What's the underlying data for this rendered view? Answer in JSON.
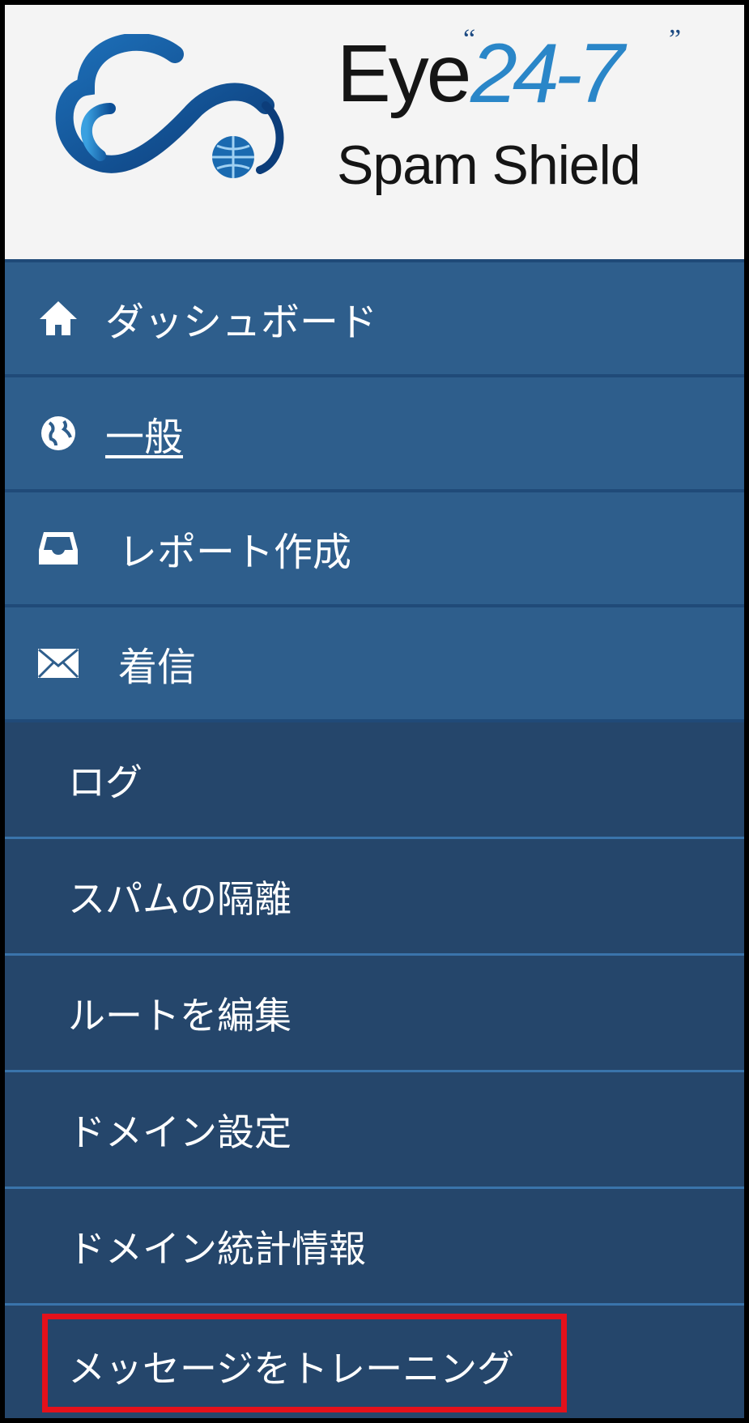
{
  "logo": {
    "brand": "Eye",
    "number": "24-7",
    "quote_open": "“",
    "quote_close": "”",
    "product": "Spam Shield"
  },
  "menu": {
    "items": [
      {
        "label": "ダッシュボード",
        "icon": "home-icon"
      },
      {
        "label": "一般",
        "icon": "globe-icon"
      },
      {
        "label": "レポート作成",
        "icon": "inbox-icon"
      },
      {
        "label": "着信",
        "icon": "envelope-icon"
      }
    ],
    "subitems": [
      {
        "label": "ログ"
      },
      {
        "label": "スパムの隔離"
      },
      {
        "label": "ルートを編集"
      },
      {
        "label": "ドメイン設定"
      },
      {
        "label": "ドメイン統計情報"
      },
      {
        "label": "メッセージをトレーニング"
      }
    ]
  },
  "colors": {
    "header_bg": "#f4f4f4",
    "main_item_bg": "#2e5e8c",
    "sub_item_bg": "#25466b",
    "highlight": "#e4111b"
  }
}
